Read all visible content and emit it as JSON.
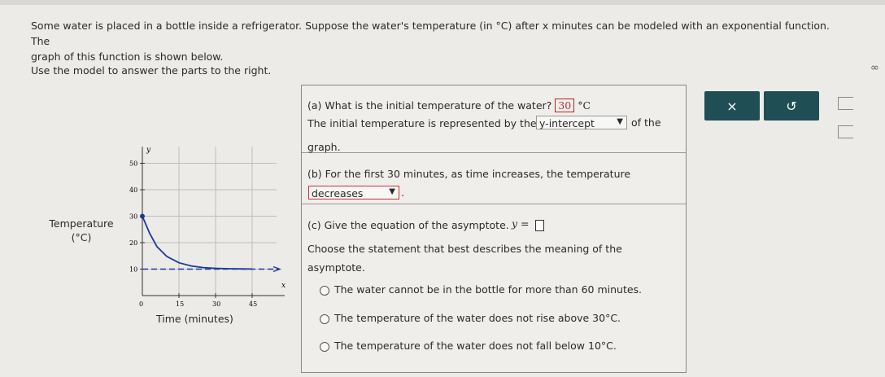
{
  "problem": {
    "intro_line1": "Some water is placed in a bottle inside a refrigerator. Suppose the water's temperature (in °C) after x minutes can be modeled with an exponential function. The",
    "intro_line2": "graph of this function is shown below.",
    "instruction": "Use the model to answer the parts to the right."
  },
  "graph": {
    "y_label_line1": "Temperature",
    "y_label_line2": "(°C)",
    "x_label": "Time (minutes)",
    "y_var": "y",
    "x_var": "x",
    "origin": "0",
    "x_ticks": [
      "15",
      "30",
      "45"
    ],
    "y_ticks": [
      "10",
      "20",
      "30",
      "40",
      "50"
    ]
  },
  "chart_data": {
    "type": "line",
    "xlabel": "Time (minutes)",
    "ylabel": "Temperature (°C)",
    "xlim": [
      0,
      55
    ],
    "ylim": [
      0,
      55
    ],
    "grid": true,
    "series": [
      {
        "x": [
          0,
          3,
          6,
          10,
          15,
          20,
          25,
          30,
          35,
          40,
          45
        ],
        "y": [
          30,
          23.5,
          18.5,
          14.8,
          12.4,
          11.2,
          10.6,
          10.3,
          10.15,
          10.08,
          10.04
        ]
      }
    ],
    "asymptote_y": 10
  },
  "part_a": {
    "question": "(a) What is the initial temperature of the water?",
    "answer": "30",
    "unit": "°C",
    "line2_pre": "The initial temperature is represented by the",
    "select_value": "y-intercept",
    "line2_post": "of the",
    "line3": "graph."
  },
  "part_b": {
    "question": "(b) For the first 30 minutes, as time increases, the temperature",
    "select_value": "decreases",
    "period": "."
  },
  "part_c": {
    "question": "(c) Give the equation of the asymptote.",
    "eq_lhs": "y =",
    "prompt_line1": "Choose the statement that best describes the meaning of the",
    "prompt_line2": "asymptote.",
    "options": [
      "The water cannot be in the bottle for more than 60 minutes.",
      "The temperature of the water does not rise above 30°C.",
      "The temperature of the water does not fall below 10°C."
    ]
  },
  "buttons": {
    "clear": "×",
    "undo": "↺"
  },
  "edge": {
    "infinity": "∞"
  }
}
